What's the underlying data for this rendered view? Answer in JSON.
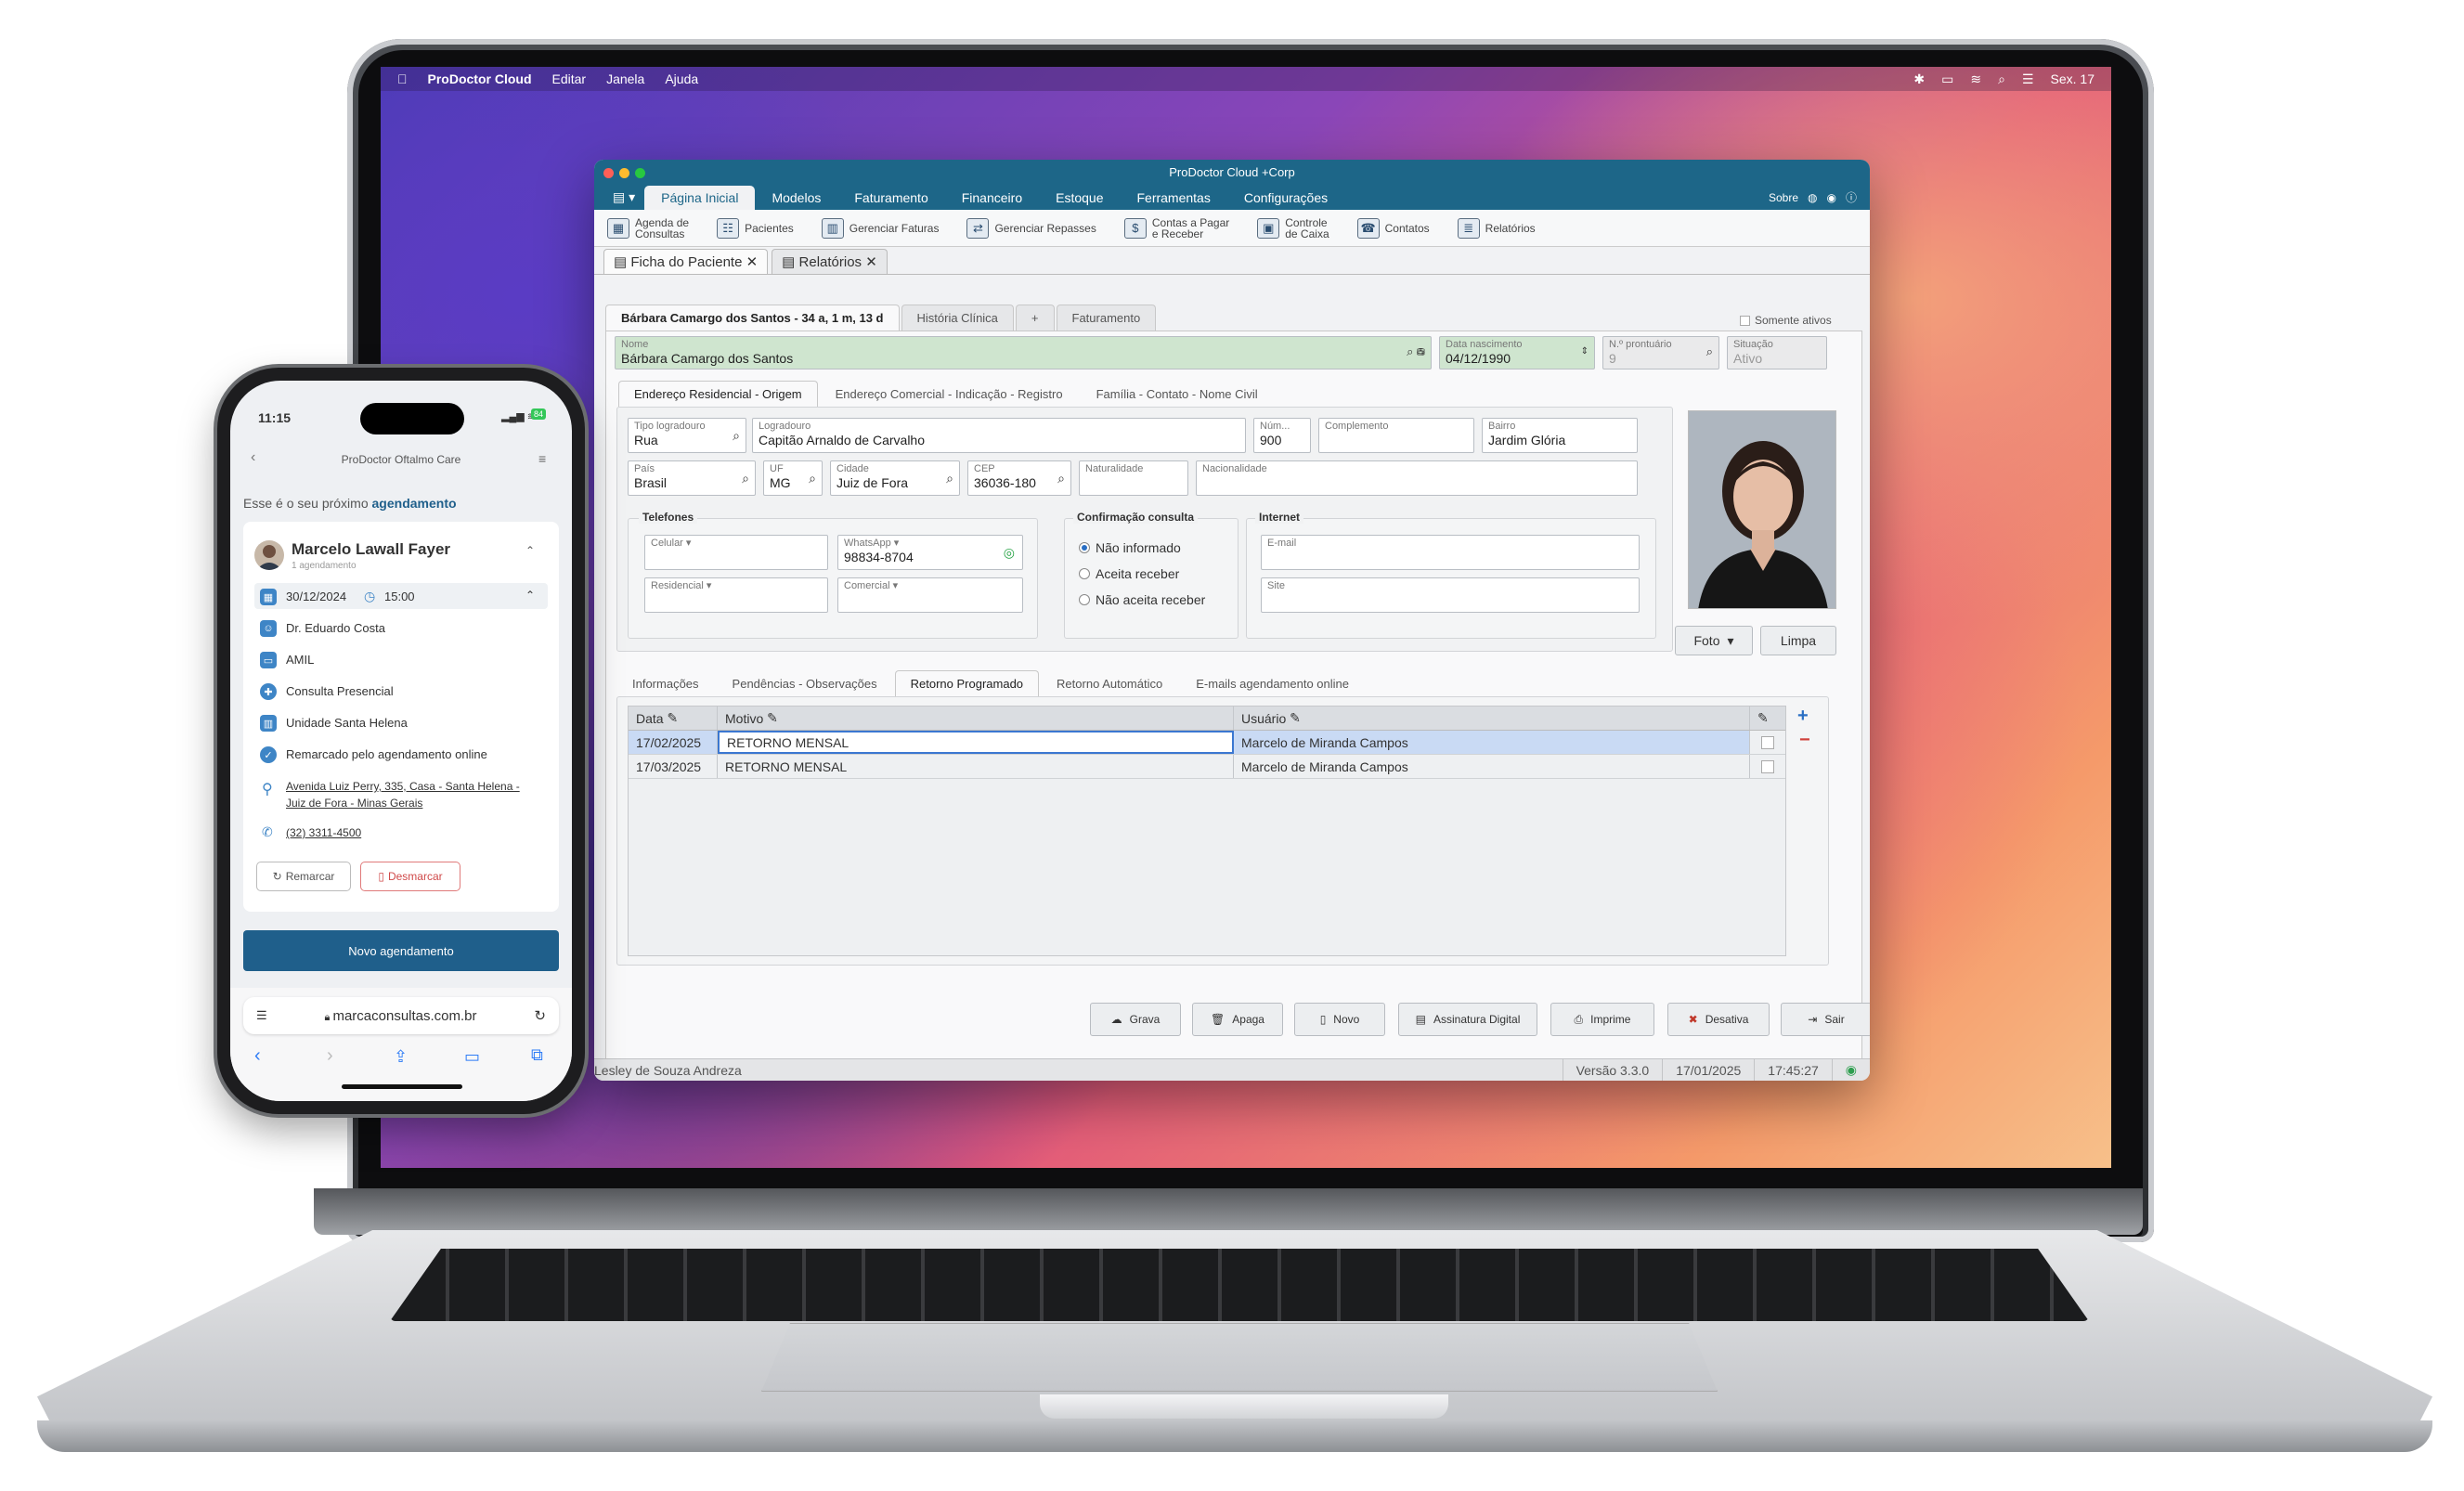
{
  "mac_menubar": {
    "app": "ProDoctor Cloud",
    "items": [
      "Editar",
      "Janela",
      "Ajuda"
    ],
    "clock": "Sex. 17"
  },
  "window": {
    "title": "ProDoctor Cloud +Corp",
    "menu_tabs": [
      "Página Inicial",
      "Modelos",
      "Faturamento",
      "Financeiro",
      "Estoque",
      "Ferramentas",
      "Configurações"
    ],
    "menu_right": "Sobre",
    "toolbar": [
      {
        "label": "Agenda de\nConsultas",
        "icon": "calendar-icon"
      },
      {
        "label": "Pacientes",
        "icon": "patients-icon"
      },
      {
        "label": "Gerenciar Faturas",
        "icon": "invoice-icon"
      },
      {
        "label": "Gerenciar Repasses",
        "icon": "transfer-icon"
      },
      {
        "label": "Contas a Pagar\ne Receber",
        "icon": "money-icon"
      },
      {
        "label": "Controle\nde Caixa",
        "icon": "cashier-icon"
      },
      {
        "label": "Contatos",
        "icon": "contacts-icon"
      },
      {
        "label": "Relatórios",
        "icon": "reports-icon"
      }
    ],
    "doc_tabs": [
      "Ficha do Paciente",
      "Relatórios"
    ],
    "patient_tabs": [
      "Bárbara Camargo dos Santos - 34 a, 1 m, 13 d",
      "História Clínica",
      "+",
      "Faturamento"
    ],
    "somente_ativos": "Somente ativos",
    "fields": {
      "nome": {
        "label": "Nome",
        "value": "Bárbara Camargo dos Santos"
      },
      "nascimento": {
        "label": "Data nascimento",
        "value": "04/12/1990"
      },
      "prontuario": {
        "label": "N.º prontuário",
        "value": "9"
      },
      "situacao": {
        "label": "Situação",
        "value": "Ativo"
      }
    },
    "address_tabs": [
      "Endereço Residencial - Origem",
      "Endereço Comercial - Indicação - Registro",
      "Família - Contato - Nome Civil"
    ],
    "address": {
      "tipo": {
        "label": "Tipo logradouro",
        "value": "Rua"
      },
      "logradouro": {
        "label": "Logradouro",
        "value": "Capitão Arnaldo de Carvalho"
      },
      "numero": {
        "label": "Núm...",
        "value": "900"
      },
      "complemento": {
        "label": "Complemento",
        "value": ""
      },
      "bairro": {
        "label": "Bairro",
        "value": "Jardim Glória"
      },
      "pais": {
        "label": "País",
        "value": "Brasil"
      },
      "uf": {
        "label": "UF",
        "value": "MG"
      },
      "cidade": {
        "label": "Cidade",
        "value": "Juiz de Fora"
      },
      "cep": {
        "label": "CEP",
        "value": "36036-180"
      },
      "naturalidade": {
        "label": "Naturalidade",
        "value": ""
      },
      "nacionalidade": {
        "label": "Nacionalidade",
        "value": ""
      }
    },
    "telefones": {
      "title": "Telefones",
      "celular": "Celular",
      "whatsapp_label": "WhatsApp",
      "whatsapp": "98834-8704",
      "residencial": "Residencial",
      "comercial": "Comercial"
    },
    "confirmacao": {
      "title": "Confirmação consulta",
      "options": [
        "Não informado",
        "Aceita receber",
        "Não aceita receber"
      ]
    },
    "internet": {
      "title": "Internet",
      "email": "E-mail",
      "site": "Site"
    },
    "photo_buttons": {
      "foto": "Foto",
      "limpa": "Limpa"
    },
    "info_tabs": [
      "Informações",
      "Pendências - Observações",
      "Retorno Programado",
      "Retorno Automático",
      "E-mails agendamento online"
    ],
    "grid": {
      "headers": [
        "Data",
        "Motivo",
        "Usuário"
      ],
      "rows": [
        [
          "17/02/2025",
          "RETORNO MENSAL",
          "Marcelo de Miranda Campos"
        ],
        [
          "17/03/2025",
          "RETORNO MENSAL",
          "Marcelo de Miranda Campos"
        ]
      ]
    },
    "actions": [
      "Grava",
      "Apaga",
      "Novo",
      "Assinatura Digital",
      "Imprime",
      "Desativa",
      "Sair"
    ],
    "status": {
      "user": "Lesley de Souza Andreza",
      "version": "Versão 3.3.0",
      "date": "17/01/2025",
      "time": "17:45:27"
    }
  },
  "phone": {
    "time": "11:15",
    "battery": "84",
    "app_title": "ProDoctor Oftalmo Care",
    "intro": "Esse é o seu próximo ",
    "intro_link": "agendamento",
    "patient": "Marcelo Lawall Fayer",
    "subtitle": "1 agendamento",
    "date": "30/12/2024",
    "time_slot": "15:00",
    "details": [
      "Dr. Eduardo Costa",
      "AMIL",
      "Consulta Presencial",
      "Unidade Santa Helena",
      "Remarcado pelo agendamento online"
    ],
    "address": "Avenida Luiz Perry, 335, Casa - Santa Helena - Juiz de Fora - Minas Gerais",
    "phone_number": "(32) 3311-4500",
    "remarcar": "Remarcar",
    "desmarcar": "Desmarcar",
    "novo": "Novo agendamento",
    "url": "marcaconsultas.com.br"
  }
}
